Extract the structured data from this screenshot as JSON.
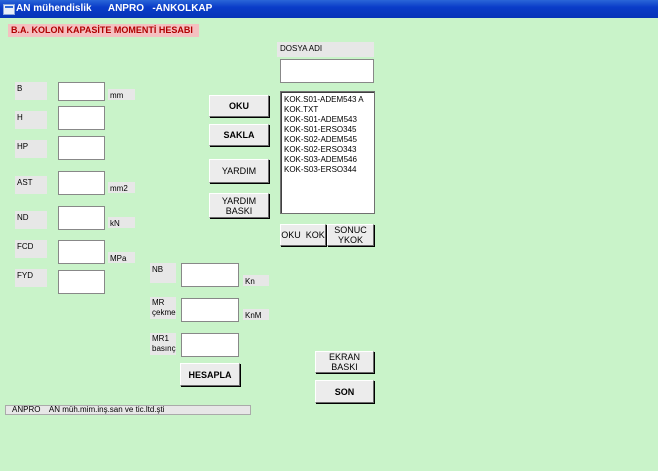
{
  "window": {
    "title": "AN mühendislik      ANPRO   -ANKOLKAP"
  },
  "header": {
    "title": "B.A. KOLON KAPASİTE MOMENTİ HESABI"
  },
  "inputs": {
    "b": {
      "label": "B",
      "unit": "mm",
      "value": ""
    },
    "h": {
      "label": "H",
      "unit": "",
      "value": ""
    },
    "hp": {
      "label": "HP",
      "unit": "",
      "value": ""
    },
    "ast": {
      "label": "AST",
      "unit": "mm2",
      "value": ""
    },
    "nd": {
      "label": "ND",
      "unit": "kN",
      "value": ""
    },
    "fcd": {
      "label": "FCD",
      "unit": "MPa",
      "value": ""
    },
    "fyd": {
      "label": "FYD",
      "unit": "",
      "value": ""
    }
  },
  "results": {
    "nb": {
      "label": "NB",
      "unit": "Kn",
      "value": ""
    },
    "mr_cekme": {
      "label": "MR\nçekme",
      "unit": "KnM",
      "value": ""
    },
    "mr1_basinc": {
      "label": "MR1\nbasınç",
      "value": ""
    }
  },
  "buttons": {
    "oku": "OKU",
    "sakla": "SAKLA",
    "yardim": "YARDIM",
    "yardim_baski": "YARDIM\nBASKI",
    "hesapla": "HESAPLA",
    "oku_kok": "OKU  KOK",
    "sonuc_ykok": "SONUC\nYKOK",
    "ekran_baski": "EKRAN BASKI",
    "son": "SON"
  },
  "file": {
    "label": "DOSYA ADI",
    "value": "",
    "list": [
      "KOK.S01-ADEM543 A",
      "KOK.TXT",
      "KOK-S01-ADEM543",
      "KOK-S01-ERSO345",
      "KOK-S02-ADEM545",
      "KOK-S02-ERSO343",
      "KOK-S03-ADEM546",
      "KOK-S03-ERSO344"
    ]
  },
  "status": {
    "text": "ANPRO    AN müh.mim.inş.san ve tic.ltd.şti"
  },
  "colors": {
    "background": "#c9f3c9",
    "titlebar": "#0a3cc8",
    "header_bg": "#f4c0c0",
    "header_text": "#b00000"
  }
}
